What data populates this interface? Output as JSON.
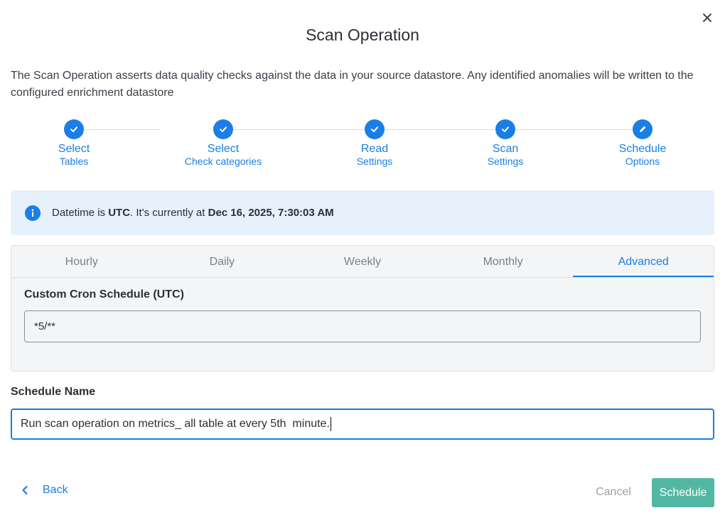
{
  "dialog": {
    "title": "Scan Operation",
    "description": "The Scan Operation asserts data quality checks against the data in your source datastore. Any identified anomalies will be written to the configured enrichment datastore"
  },
  "steps": [
    {
      "title": "Select",
      "sub": "Tables",
      "state": "done"
    },
    {
      "title": "Select",
      "sub": "Check categories",
      "state": "done"
    },
    {
      "title": "Read",
      "sub": "Settings",
      "state": "done"
    },
    {
      "title": "Scan",
      "sub": "Settings",
      "state": "done"
    },
    {
      "title": "Schedule",
      "sub": "Options",
      "state": "editing"
    }
  ],
  "info": {
    "prefix": "Datetime is ",
    "timezone": "UTC",
    "middle": ". It's currently at ",
    "current_time": "Dec 16, 2025, 7:30:03 AM"
  },
  "tabs": [
    "Hourly",
    "Daily",
    "Weekly",
    "Monthly",
    "Advanced"
  ],
  "active_tab": "Advanced",
  "cron": {
    "label": "Custom Cron Schedule (UTC)",
    "value": "*5/**"
  },
  "schedule_name": {
    "label": "Schedule Name",
    "value": "Run scan operation on metrics_ all table at every 5th  minute."
  },
  "footer": {
    "back_label": "Back",
    "cancel_label": "Cancel",
    "schedule_label": "Schedule"
  },
  "colors": {
    "accent": "#1a7ee6",
    "info_bg": "#e6f1fc",
    "schedule_button": "#52b8a4"
  },
  "icons": {
    "close": "close-icon",
    "step_done": "check-icon",
    "step_editing": "pencil-icon",
    "info": "info-icon",
    "back": "chevron-left-icon"
  }
}
